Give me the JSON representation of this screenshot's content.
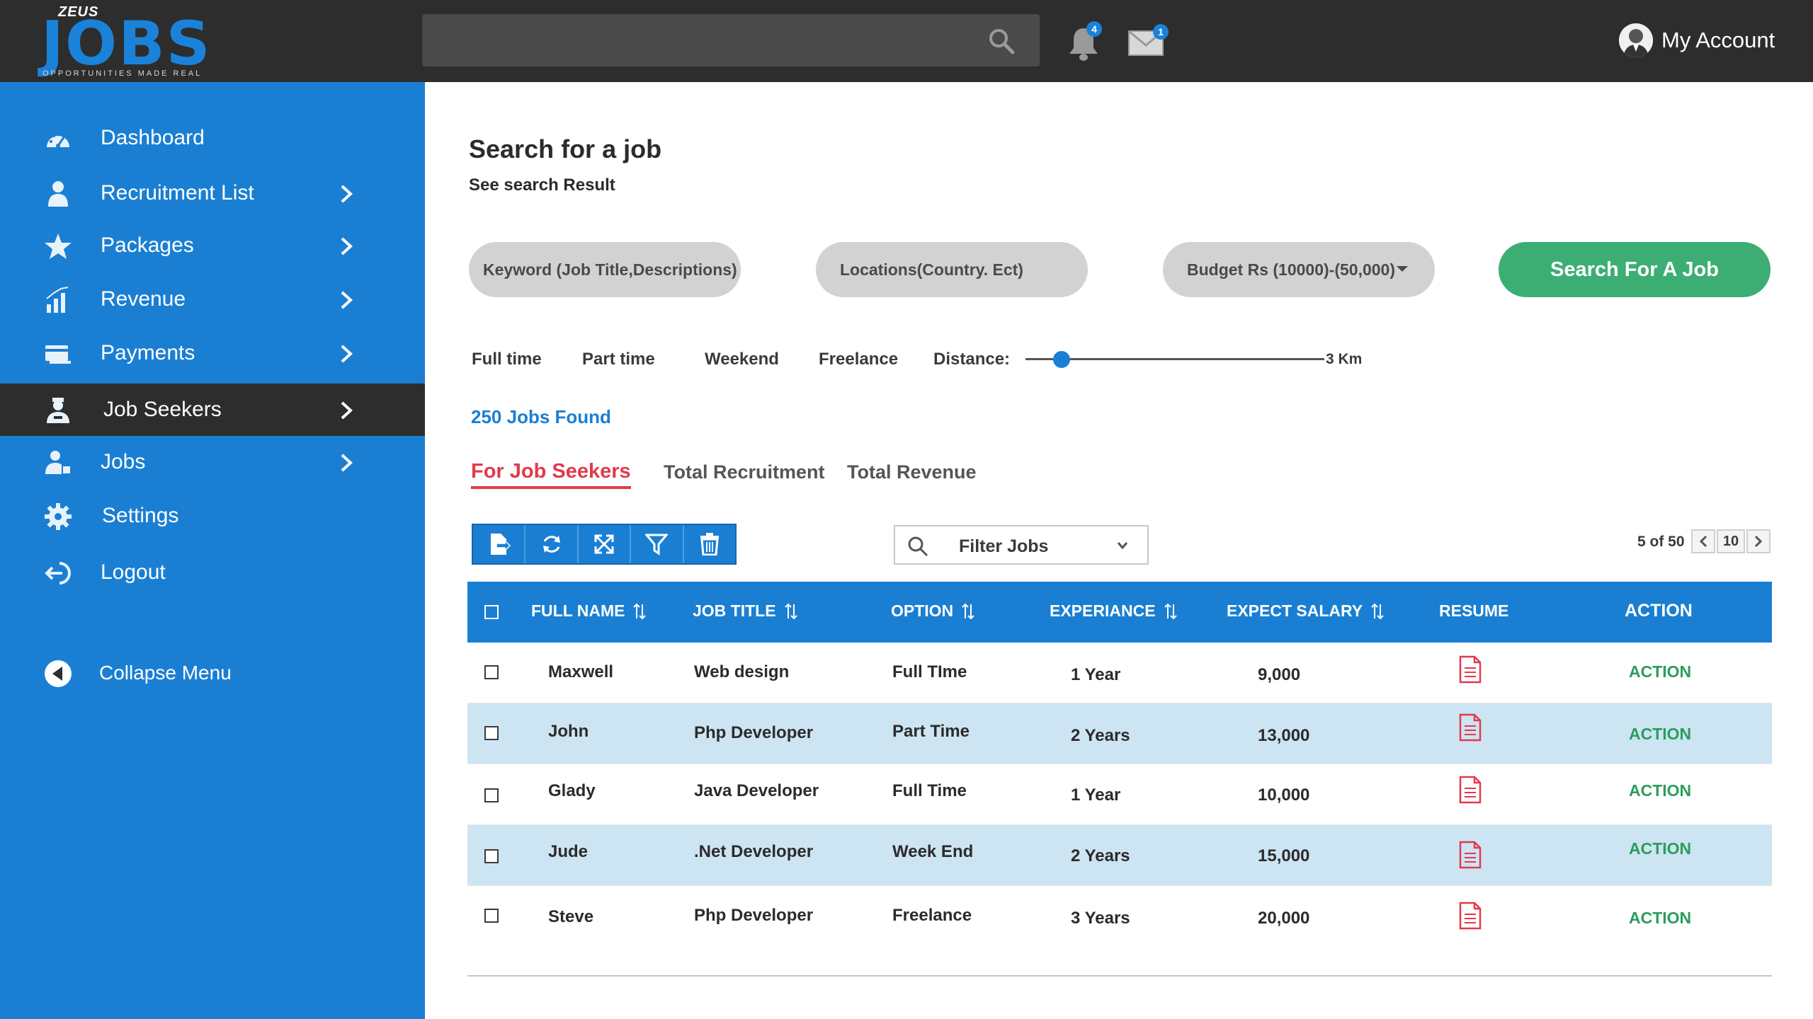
{
  "header": {
    "brand_small": "ZEUS",
    "brand_main": "JOBS",
    "brand_tagline": "OPPORTUNITIES MADE REAL",
    "notifications_count": "4",
    "messages_count": "1",
    "account_label": "My Account"
  },
  "sidebar": {
    "items": [
      {
        "label": "Dashboard",
        "icon": "dashboard-icon"
      },
      {
        "label": "Recruitment List",
        "icon": "user-icon"
      },
      {
        "label": "Packages",
        "icon": "star-icon"
      },
      {
        "label": "Revenue",
        "icon": "chart-icon"
      },
      {
        "label": "Payments",
        "icon": "card-icon"
      },
      {
        "label": "Job Seekers",
        "icon": "job-seeker-icon"
      },
      {
        "label": "Jobs",
        "icon": "jobs-icon"
      },
      {
        "label": "Settings",
        "icon": "gear-icon"
      },
      {
        "label": "Logout",
        "icon": "logout-icon"
      }
    ],
    "collapse_label": "Collapse Menu",
    "active_item": "Job Seekers"
  },
  "main": {
    "title": "Search for a job",
    "subtitle": "See search Result",
    "keyword_placeholder": "Keyword (Job Title,Descriptions)",
    "location_placeholder": "Locations(Country. Ect)",
    "budget_value": "Budget Rs (10000)-(50,000)",
    "search_button": "Search For A Job",
    "job_types": [
      "Full time",
      "Part time",
      "Weekend",
      "Freelance"
    ],
    "distance_label": "Distance:",
    "distance_value": "3 Km",
    "distance_fraction": 0.12,
    "jobs_found": "250 Jobs Found",
    "tabs": [
      "For Job Seekers",
      "Total Recruitment",
      "Total Revenue"
    ],
    "filter_label": "Filter Jobs",
    "pager_text": "5 of 50",
    "pager_size": "10"
  },
  "table": {
    "headers": {
      "full_name": "FULL NAME",
      "job_title": "JOB TITLE",
      "option": "OPTION",
      "experience": "EXPERIANCE",
      "salary": "EXPECT SALARY",
      "resume": "RESUME",
      "action": "ACTION"
    },
    "rows": [
      {
        "name": "Maxwell",
        "title": "Web design",
        "option": "Full TIme",
        "experience": "1 Year",
        "salary": "9,000",
        "action": "ACTION"
      },
      {
        "name": "John",
        "title": "Php Developer",
        "option": "Part Time",
        "experience": "2 Years",
        "salary": "13,000",
        "action": "ACTION"
      },
      {
        "name": "Glady",
        "title": "Java Developer",
        "option": "Full Time",
        "experience": "1 Year",
        "salary": "10,000",
        "action": "ACTION"
      },
      {
        "name": "Jude",
        "title": ".Net Developer",
        "option": "Week End",
        "experience": "2 Years",
        "salary": "15,000",
        "action": "ACTION"
      },
      {
        "name": "Steve",
        "title": "Php Developer",
        "option": "Freelance",
        "experience": "3 Years",
        "salary": "20,000",
        "action": "ACTION"
      }
    ]
  },
  "colors": {
    "primary": "#1a7fd3",
    "topbar": "#2d2d2d",
    "success": "#3cae74",
    "tab_active": "#e23a4a",
    "row_alt": "#cde4f3"
  }
}
